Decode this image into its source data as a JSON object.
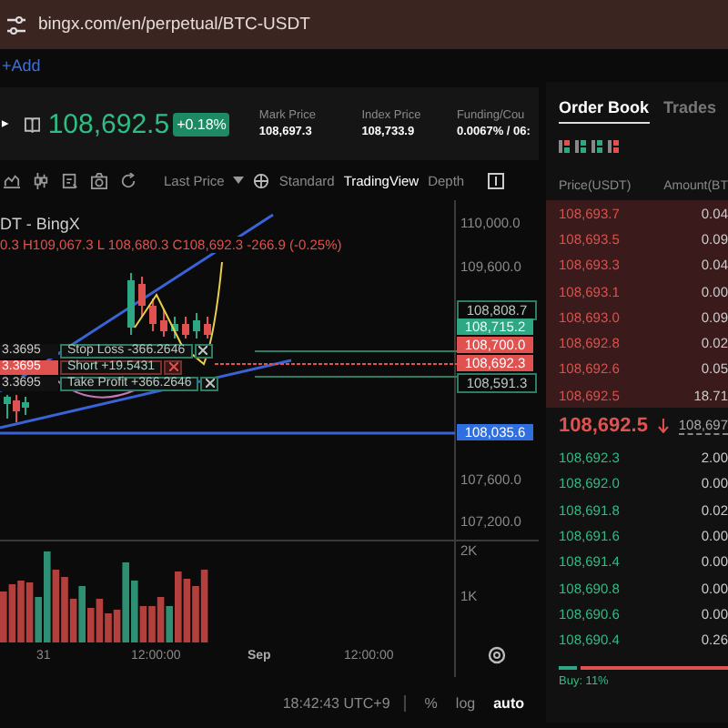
{
  "browser": {
    "url": "bingx.com/en/perpetual/BTC-USDT"
  },
  "add_link": "+Add",
  "ticker": {
    "price": "108,692.5",
    "change": "+0.18%",
    "stats": [
      {
        "label": "Mark Price",
        "value": "108,697.3"
      },
      {
        "label": "Index Price",
        "value": "108,733.9"
      },
      {
        "label": "Funding/Cou",
        "value": "0.0067% / 06:"
      }
    ]
  },
  "toolbar": {
    "price_source": "Last Price",
    "views": [
      {
        "label": "Standard",
        "selected": false
      },
      {
        "label": "TradingView",
        "selected": true
      },
      {
        "label": "Depth",
        "selected": false
      }
    ]
  },
  "chart": {
    "title": "DT - BingX",
    "ohlc": "0.3 H109,067.3 L 108,680.3 C108,692.3 -266.9 (-0.25%)",
    "positions": [
      {
        "kind": "stop_loss",
        "quantity": "3.3695",
        "label": "Stop Loss -366.2646"
      },
      {
        "kind": "short",
        "quantity": "3.3695",
        "label": "Short +19.5431"
      },
      {
        "kind": "take_profit",
        "quantity": "3.3695",
        "label": "Take Profit +366.2646"
      }
    ],
    "price_axis": [
      {
        "label": "110,000.0",
        "kind": "plain"
      },
      {
        "label": "109,600.0",
        "kind": "plain"
      },
      {
        "label": "108,808.7",
        "kind": "outline"
      },
      {
        "label": "108,715.2",
        "kind": "green"
      },
      {
        "label": "108,700.0",
        "kind": "red"
      },
      {
        "label": "108,692.3",
        "kind": "red"
      },
      {
        "label": "108,591.3",
        "kind": "outline"
      },
      {
        "label": "108,035.6",
        "kind": "blue"
      },
      {
        "label": "107,600.0",
        "kind": "plain"
      },
      {
        "label": "107,200.0",
        "kind": "plain"
      },
      {
        "label": "2K",
        "kind": "plain"
      },
      {
        "label": "1K",
        "kind": "plain"
      }
    ],
    "time_axis": [
      "31",
      "12:00:00",
      "Sep",
      "12:00:00"
    ]
  },
  "status_bar": {
    "time": "18:42:43 UTC+9",
    "options": [
      {
        "label": "%",
        "selected": false
      },
      {
        "label": "log",
        "selected": false
      },
      {
        "label": "auto",
        "selected": true
      }
    ]
  },
  "order_book": {
    "tabs": [
      {
        "label": "Order Book",
        "selected": true
      },
      {
        "label": "Trades",
        "selected": false
      }
    ],
    "columns": [
      "Price(USDT)",
      "Amount(BT"
    ],
    "asks": [
      {
        "price": "108,693.7",
        "amount": "0.04"
      },
      {
        "price": "108,693.5",
        "amount": "0.09"
      },
      {
        "price": "108,693.3",
        "amount": "0.04"
      },
      {
        "price": "108,693.1",
        "amount": "0.00"
      },
      {
        "price": "108,693.0",
        "amount": "0.09"
      },
      {
        "price": "108,692.8",
        "amount": "0.02"
      },
      {
        "price": "108,692.6",
        "amount": "0.05"
      },
      {
        "price": "108,692.5",
        "amount": "18.71"
      }
    ],
    "last_price": "108,692.5",
    "mark_price": "108,697",
    "bids": [
      {
        "price": "108,692.3",
        "amount": "2.00"
      },
      {
        "price": "108,692.0",
        "amount": "0.00"
      },
      {
        "price": "108,691.8",
        "amount": "0.02"
      },
      {
        "price": "108,691.6",
        "amount": "0.00"
      },
      {
        "price": "108,691.4",
        "amount": "0.00"
      },
      {
        "price": "108,690.8",
        "amount": "0.00"
      },
      {
        "price": "108,690.6",
        "amount": "0.00"
      },
      {
        "price": "108,690.4",
        "amount": "0.26"
      }
    ],
    "buy_share": {
      "label": "Buy: 11%",
      "level": 0.11
    }
  }
}
